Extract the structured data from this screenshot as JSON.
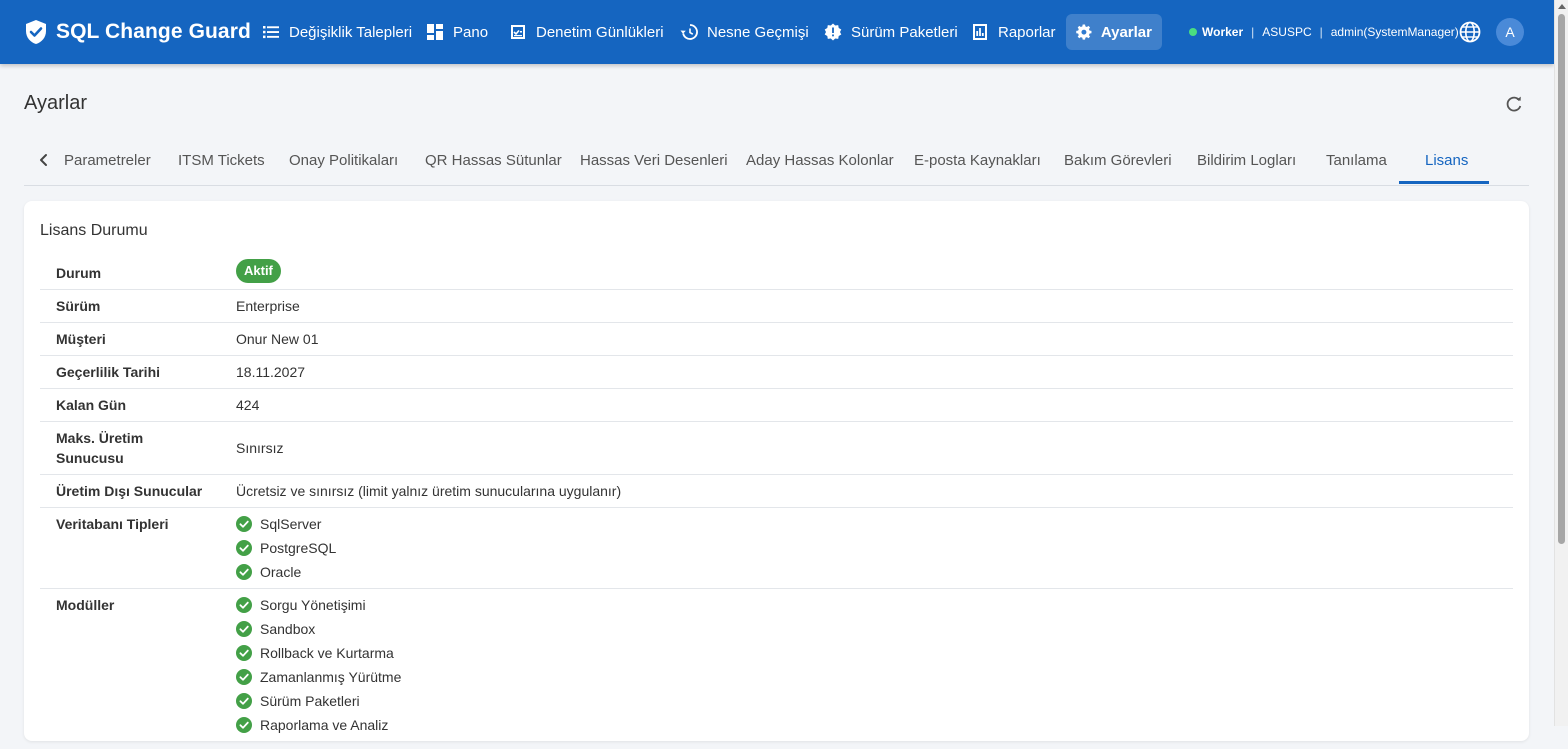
{
  "app": {
    "title": "SQL Change Guard"
  },
  "nav": {
    "items": [
      {
        "label": "Değişiklik Talepleri",
        "icon": "list-icon"
      },
      {
        "label": "Pano",
        "icon": "dashboard-icon"
      },
      {
        "label": "Denetim Günlükleri",
        "icon": "audit-log-icon"
      },
      {
        "label": "Nesne Geçmişi",
        "icon": "history-icon"
      },
      {
        "label": "Sürüm Paketleri",
        "icon": "release-package-icon"
      },
      {
        "label": "Raporlar",
        "icon": "bar-chart-icon"
      },
      {
        "label": "Ayarlar",
        "icon": "gear-icon",
        "active": true
      }
    ]
  },
  "status": {
    "worker_label": "Worker",
    "host": "ASUSPC",
    "user": "admin(SystemManager)",
    "separator": "|",
    "worker_color": "#4ade80"
  },
  "avatar": {
    "initial": "A"
  },
  "page": {
    "title": "Ayarlar"
  },
  "tabs": [
    {
      "label": "Parametreler"
    },
    {
      "label": "ITSM Tickets"
    },
    {
      "label": "Onay Politikaları"
    },
    {
      "label": "QR Hassas Sütunlar"
    },
    {
      "label": "Hassas Veri Desenleri"
    },
    {
      "label": "Aday Hassas Kolonlar"
    },
    {
      "label": "E-posta Kaynakları"
    },
    {
      "label": "Bakım Görevleri"
    },
    {
      "label": "Bildirim Logları"
    },
    {
      "label": "Tanılama"
    },
    {
      "label": "Lisans",
      "active": true
    }
  ],
  "license": {
    "title": "Lisans Durumu",
    "rows": {
      "status": {
        "label": "Durum",
        "value": "Aktif"
      },
      "edition": {
        "label": "Sürüm",
        "value": "Enterprise"
      },
      "customer": {
        "label": "Müşteri",
        "value": "Onur New 01"
      },
      "expiry": {
        "label": "Geçerlilik Tarihi",
        "value": "18.11.2027"
      },
      "days_left": {
        "label": "Kalan Gün",
        "value": "424"
      },
      "max_prod": {
        "label": "Maks. Üretim Sunucusu",
        "value": "Sınırsız"
      },
      "non_prod": {
        "label": "Üretim Dışı Sunucular",
        "value": "Ücretsiz ve sınırsız (limit yalnız üretim sunucularına uygulanır)"
      },
      "db_types": {
        "label": "Veritabanı Tipleri",
        "items": [
          "SqlServer",
          "PostgreSQL",
          "Oracle"
        ]
      },
      "modules": {
        "label": "Modüller",
        "items": [
          "Sorgu Yönetişimi",
          "Sandbox",
          "Rollback ve Kurtarma",
          "Zamanlanmış Yürütme",
          "Sürüm Paketleri",
          "Raporlama ve Analiz"
        ]
      }
    }
  },
  "colors": {
    "primary": "#1565c0",
    "success": "#43a047"
  }
}
